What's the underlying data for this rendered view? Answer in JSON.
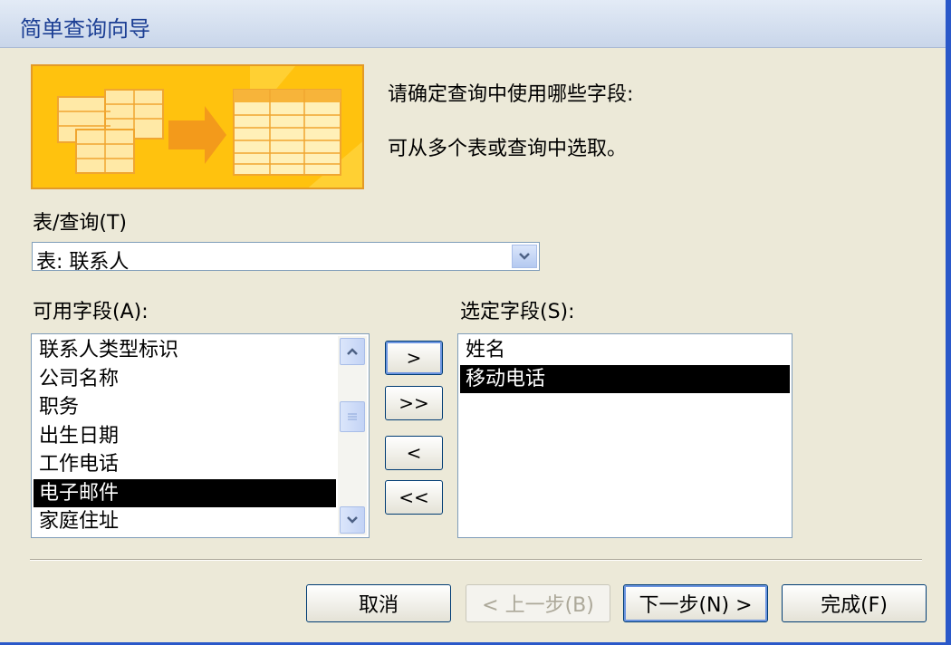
{
  "window": {
    "title": "简单查询向导"
  },
  "instructions": {
    "line1": "请确定查询中使用哪些字段:",
    "line2": "可从多个表或查询中选取。"
  },
  "table_query": {
    "label": "表/查询(T)",
    "selected": "表: 联系人"
  },
  "available_fields": {
    "label": "可用字段(A):",
    "items": [
      "联系人类型标识",
      "公司名称",
      "职务",
      "出生日期",
      "工作电话",
      "电子邮件",
      "家庭住址"
    ],
    "selected_item": "电子邮件"
  },
  "selected_fields": {
    "label": "选定字段(S):",
    "items": [
      "姓名",
      "移动电话"
    ],
    "selected_item": "移动电话"
  },
  "move_buttons": {
    "add_one": ">",
    "add_all": ">>",
    "remove_one": "<",
    "remove_all": "<<"
  },
  "footer": {
    "cancel": "取消",
    "back": "< 上一步(B)",
    "next": "下一步(N) >",
    "finish": "完成(F)"
  },
  "colors": {
    "titlebar_text": "#1c3f94",
    "selection": "#000000",
    "banner": "#ffc20e"
  }
}
